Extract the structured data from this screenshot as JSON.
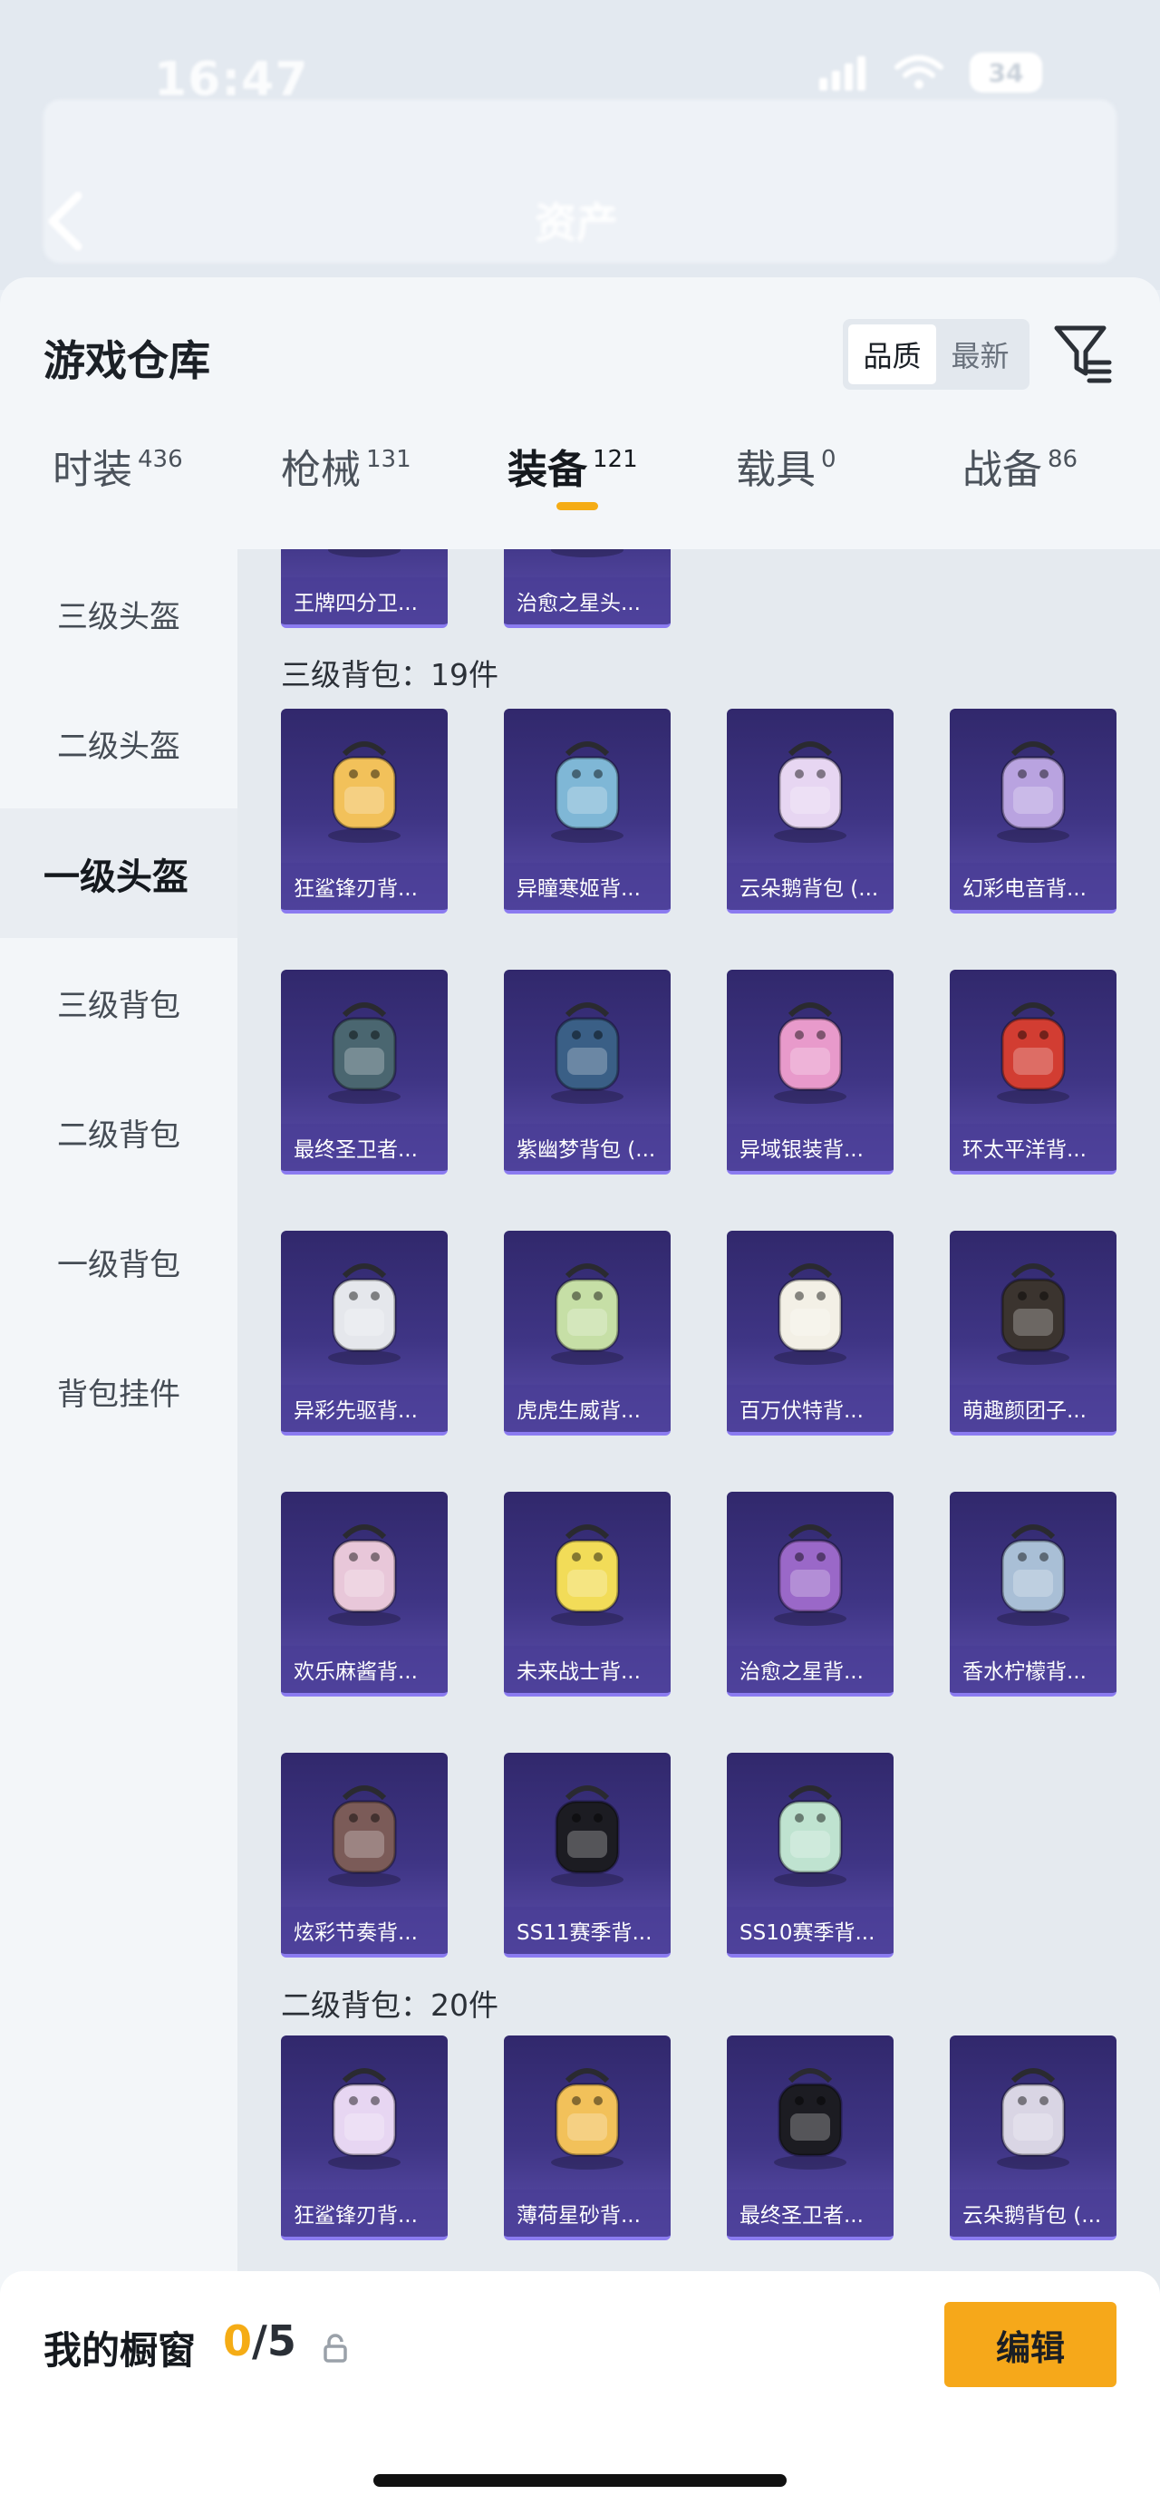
{
  "status_bar": {
    "time": "16:47",
    "battery": "34"
  },
  "header_bg": {
    "title": "资产"
  },
  "sheet": {
    "title": "游戏仓库",
    "sort": {
      "options": [
        "品质",
        "最新"
      ],
      "selected": "品质"
    }
  },
  "tabs": [
    {
      "label": "时装",
      "count": "436",
      "active": false
    },
    {
      "label": "枪械",
      "count": "131",
      "active": false
    },
    {
      "label": "装备",
      "count": "121",
      "active": true
    },
    {
      "label": "载具",
      "count": "0",
      "active": false
    },
    {
      "label": "战备",
      "count": "86",
      "active": false
    }
  ],
  "sidebar": {
    "items": [
      {
        "label": "三级头盔",
        "active": false
      },
      {
        "label": "二级头盔",
        "active": false
      },
      {
        "label": "一级头盔",
        "active": true
      },
      {
        "label": "三级背包",
        "active": false
      },
      {
        "label": "二级背包",
        "active": false
      },
      {
        "label": "一级背包",
        "active": false
      },
      {
        "label": "背包挂件",
        "active": false
      }
    ]
  },
  "content": {
    "top_partial_items": [
      "王牌四分卫...",
      "治愈之星头..."
    ],
    "sections": [
      {
        "label": "三级背包：19件",
        "items": [
          "狂鲨锋刃背...",
          "异瞳寒姬背...",
          "云朵鹅背包 (...",
          "幻彩电音背...",
          "最终圣卫者...",
          "紫幽梦背包 (...",
          "异域银装背...",
          "环太平洋背...",
          "异彩先驱背...",
          "虎虎生威背...",
          "百万伏特背...",
          "萌趣颜团子...",
          "欢乐麻酱背...",
          "未来战士背...",
          "治愈之星背...",
          "香水柠檬背...",
          "炫彩节奏背...",
          "SS11赛季背...",
          "SS10赛季背..."
        ]
      },
      {
        "label": "二级背包：20件",
        "items": [
          "狂鲨锋刃背...",
          "薄荷星砂背...",
          "最终圣卫者...",
          "云朵鹅背包 (..."
        ]
      }
    ]
  },
  "bottom_bar": {
    "title": "我的橱窗",
    "count_current": "0",
    "count_total": "/5",
    "edit_label": "编辑"
  },
  "colors": {
    "accent": "#f5ac15",
    "card_top": "#31286c",
    "card_bottom": "#5d4fad"
  }
}
